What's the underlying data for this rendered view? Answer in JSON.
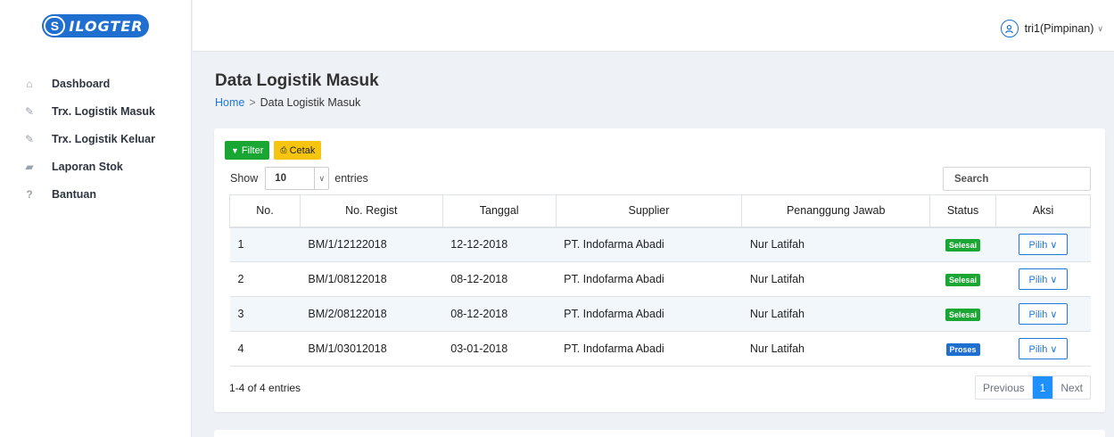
{
  "app": {
    "logo_letter": "S",
    "logo_text": "ILOGTER",
    "brand_color": "#1e6fd0"
  },
  "sidebar": {
    "items": [
      {
        "label": "Dashboard",
        "icon": "home-icon"
      },
      {
        "label": "Trx. Logistik Masuk",
        "icon": "edit-icon"
      },
      {
        "label": "Trx. Logistik Keluar",
        "icon": "edit-icon"
      },
      {
        "label": "Laporan Stok",
        "icon": "book-icon"
      },
      {
        "label": "Bantuan",
        "icon": "help-icon"
      }
    ]
  },
  "header": {
    "user": "tri1(Pimpinan)"
  },
  "page": {
    "title": "Data Logistik Masuk",
    "breadcrumb": {
      "home": "Home",
      "sep": ">",
      "current": "Data Logistik Masuk"
    }
  },
  "toolbar": {
    "filter_label": "Filter",
    "print_label": "Cetak"
  },
  "entries": {
    "show": "Show",
    "value": "10",
    "suffix": "entries"
  },
  "search": {
    "placeholder": "Search"
  },
  "table": {
    "columns": [
      "No.",
      "No. Regist",
      "Tanggal",
      "Supplier",
      "Penanggung Jawab",
      "Status",
      "Aksi"
    ],
    "rows": [
      {
        "no": "1",
        "regist": "BM/1/12122018",
        "date": "12-12-2018",
        "supplier": "PT. Indofarma Abadi",
        "pj": "Nur Latifah",
        "status": "Selesai",
        "action": "Pilih"
      },
      {
        "no": "2",
        "regist": "BM/1/08122018",
        "date": "08-12-2018",
        "supplier": "PT. Indofarma Abadi",
        "pj": "Nur Latifah",
        "status": "Selesai",
        "action": "Pilih"
      },
      {
        "no": "3",
        "regist": "BM/2/08122018",
        "date": "08-12-2018",
        "supplier": "PT. Indofarma Abadi",
        "pj": "Nur Latifah",
        "status": "Selesai",
        "action": "Pilih"
      },
      {
        "no": "4",
        "regist": "BM/1/03012018",
        "date": "03-01-2018",
        "supplier": "PT. Indofarma Abadi",
        "pj": "Nur Latifah",
        "status": "Proses",
        "action": "Pilih"
      }
    ],
    "status_colors": {
      "Selesai": "#1aa632",
      "Proses": "#1e6fd0"
    }
  },
  "footer": {
    "info": "1-4 of 4 entries",
    "prev": "Previous",
    "page": "1",
    "next": "Next"
  }
}
